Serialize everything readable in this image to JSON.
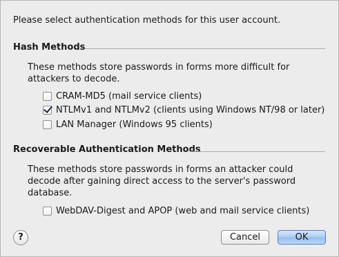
{
  "intro": "Please select authentication methods for this user account.",
  "hash_section": {
    "title": "Hash Methods",
    "description": "These methods store passwords in forms more difficult for attackers to decode.",
    "options": [
      {
        "label": "CRAM-MD5 (mail service clients)",
        "checked": false
      },
      {
        "label": "NTLMv1 and NTLMv2 (clients using Windows NT/98 or later)",
        "checked": true
      },
      {
        "label": "LAN Manager (Windows 95 clients)",
        "checked": false
      }
    ]
  },
  "recoverable_section": {
    "title": "Recoverable Authentication Methods",
    "description": "These methods store passwords in forms an attacker could decode after gaining direct access to the server's password database.",
    "options": [
      {
        "label": "WebDAV-Digest and APOP (web and mail service clients)",
        "checked": false
      }
    ]
  },
  "buttons": {
    "help": "?",
    "cancel": "Cancel",
    "ok": "OK"
  }
}
